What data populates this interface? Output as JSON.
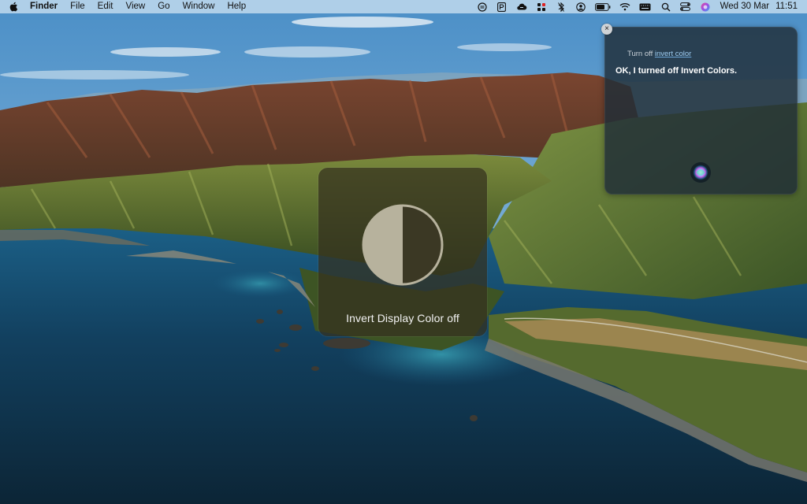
{
  "menubar": {
    "apple_icon": "apple-logo-icon",
    "items": [
      {
        "label": "Finder"
      },
      {
        "label": "File"
      },
      {
        "label": "Edit"
      },
      {
        "label": "View"
      },
      {
        "label": "Go"
      },
      {
        "label": "Window"
      },
      {
        "label": "Help"
      }
    ],
    "tray_icons": [
      "focus-icon",
      "p-badge-icon",
      "cloud-sync-icon",
      "grid-app-icon",
      "bluetooth-icon",
      "user-icon",
      "battery-icon",
      "wifi-icon",
      "keyboard-input-icon",
      "spotlight-search-icon",
      "control-center-icon",
      "siri-icon"
    ],
    "date": "Wed 30 Mar",
    "time": "11:51"
  },
  "hud": {
    "icon": "invert-display-icon",
    "label": "Invert Display Color off"
  },
  "siri": {
    "close_label": "×",
    "query_prefix": "Turn off ",
    "query_highlight": "invert color",
    "response": "OK, I turned off Invert Colors.",
    "orb_icon": "siri-orb-icon"
  },
  "colors": {
    "menubar_bg": "#c8def0",
    "siri_panel_bg": "#202d37",
    "hud_bg": "#34301e",
    "siri_query_highlight": "#9ecdf2"
  }
}
